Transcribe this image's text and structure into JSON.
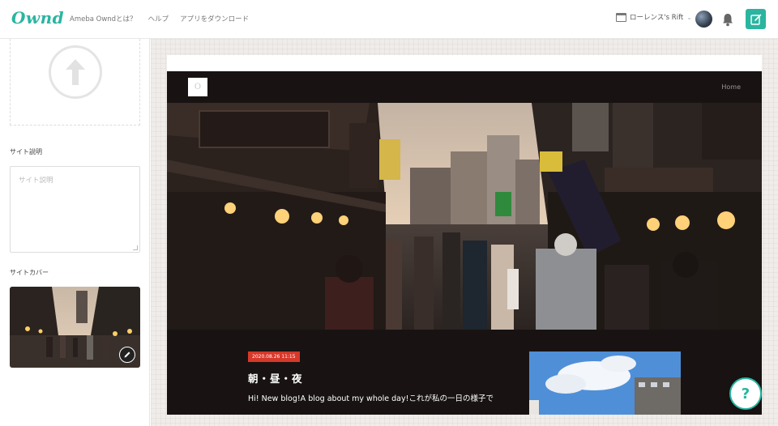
{
  "header": {
    "logo": "Ownd",
    "nav": [
      "Ameba Owndとは？",
      "ヘルプ",
      "アプリをダウンロード"
    ],
    "site_name": "ローレンス's Rift",
    "accent": "#2ab5a0"
  },
  "sidebar": {
    "description_label": "サイト説明",
    "description_placeholder": "サイト説明",
    "cover_label": "サイトカバー"
  },
  "blog": {
    "logo_text": "O",
    "nav_home": "Home",
    "post": {
      "date": "2020.08.26 11:15",
      "title": "朝・昼・夜",
      "excerpt": "Hi! New blog!A blog about my whole day!これが私の一日の様子で"
    }
  },
  "help": {
    "label": "?"
  },
  "icons": [
    "upload-icon",
    "window-icon",
    "chevron-down-icon",
    "bell-icon",
    "edit-icon",
    "pencil-icon"
  ]
}
